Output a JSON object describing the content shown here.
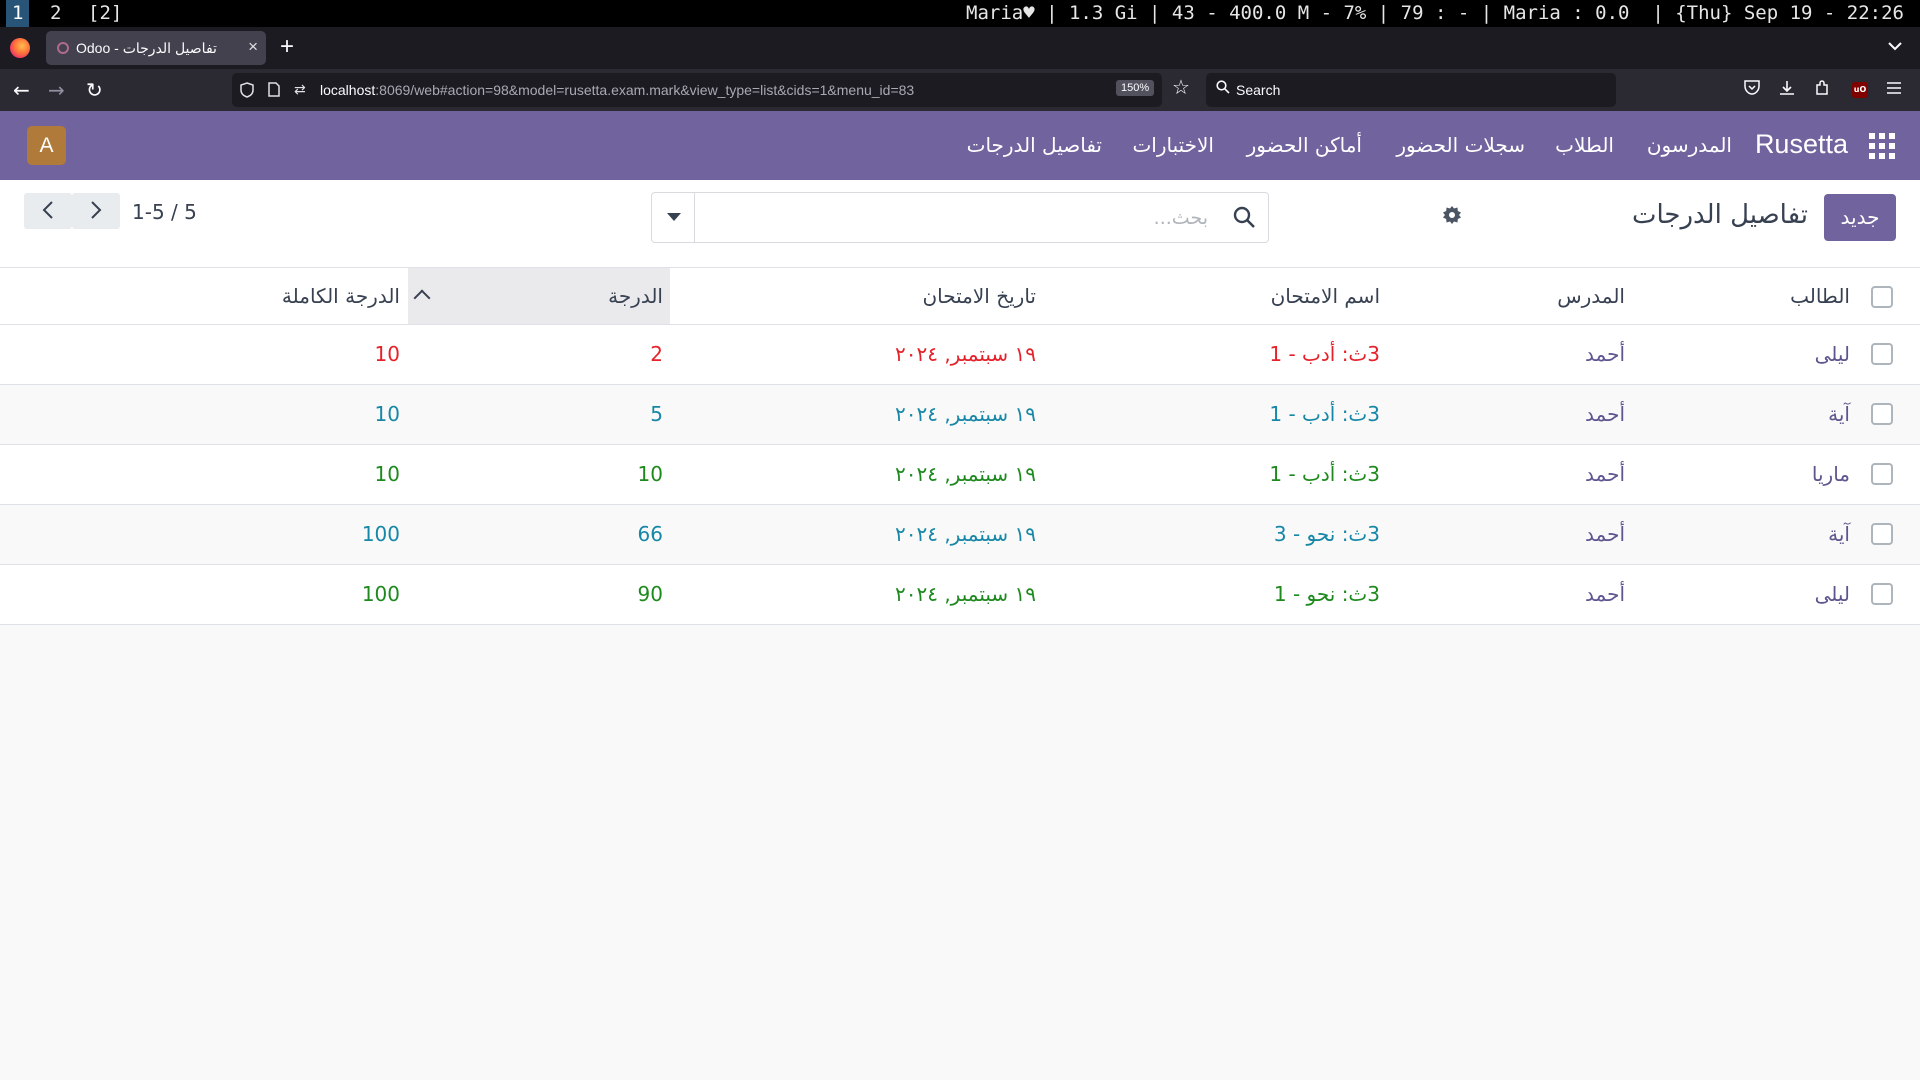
{
  "sysbar": {
    "workspaces": [
      "1",
      "2",
      "[2]"
    ],
    "status": "Maria♥ | 1.3 Gi | 43 - 400.0 M - 7% | 79 : - | Maria : 0.0  | {Thu} Sep 19 - 22:26"
  },
  "browser": {
    "tab_title": "Odoo - تفاصيل الدرجات",
    "url_host": "localhost",
    "url_rest": ":8069/web#action=98&model=rusetta.exam.mark&view_type=list&cids=1&menu_id=83",
    "zoom": "150%",
    "search_placeholder": "Search"
  },
  "odoo_nav": {
    "brand": "Rusetta",
    "menu": [
      "المدرسون",
      "الطلاب",
      "سجلات الحضور",
      "أماكن الحضور",
      "الاختبارات",
      "تفاصيل الدرجات"
    ],
    "avatar": "A"
  },
  "control_panel": {
    "new_button": "جديد",
    "title": "تفاصيل الدرجات",
    "search_placeholder": "بحث...",
    "pager": "1-5 / 5"
  },
  "table": {
    "headers": {
      "student": "الطالب",
      "teacher": "المدرس",
      "exam": "اسم الامتحان",
      "date": "تاريخ الامتحان",
      "grade": "الدرجة",
      "full": "الدرجة الكاملة"
    },
    "rows": [
      {
        "student": "ليلى",
        "teacher": "أحمد",
        "exam": "3ث: أدب - 1",
        "date": "١٩ سبتمبر, ٢٠٢٤",
        "grade": "2",
        "full": "10",
        "color": "#e5222a"
      },
      {
        "student": "آية",
        "teacher": "أحمد",
        "exam": "3ث: أدب - 1",
        "date": "١٩ سبتمبر, ٢٠٢٤",
        "grade": "5",
        "full": "10",
        "color": "#1687a7"
      },
      {
        "student": "ماريا",
        "teacher": "أحمد",
        "exam": "3ث: أدب - 1",
        "date": "١٩ سبتمبر, ٢٠٢٤",
        "grade": "10",
        "full": "10",
        "color": "#1e8a1e"
      },
      {
        "student": "آية",
        "teacher": "أحمد",
        "exam": "3ث: نحو - 3",
        "date": "١٩ سبتمبر, ٢٠٢٤",
        "grade": "66",
        "full": "100",
        "color": "#1687a7"
      },
      {
        "student": "ليلى",
        "teacher": "أحمد",
        "exam": "3ث: نحو - 1",
        "date": "١٩ سبتمبر, ٢٠٢٤",
        "grade": "90",
        "full": "100",
        "color": "#1e8a1e"
      }
    ]
  },
  "colors": {
    "brand": "#71639e",
    "link": "#5d558f",
    "danger": "#e5222a",
    "info": "#1687a7",
    "success": "#1e8a1e"
  }
}
